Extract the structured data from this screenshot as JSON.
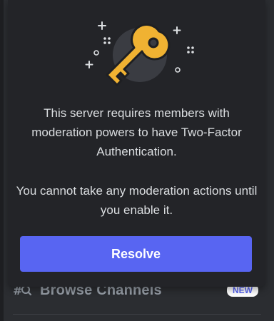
{
  "popup": {
    "illustration_icon": "key-icon",
    "message_primary": "This server requires members with moderation powers to have Two-Factor Authentication.",
    "message_secondary": "You cannot take any moderation actions until you enable it.",
    "resolve_label": "Resolve",
    "accent_color": "#5865f2",
    "key_color": "#f0b232"
  },
  "channel_list": {
    "browse_icon": "browse-channels-icon",
    "browse_label": "Browse Channels",
    "badge_label": "NEW"
  }
}
